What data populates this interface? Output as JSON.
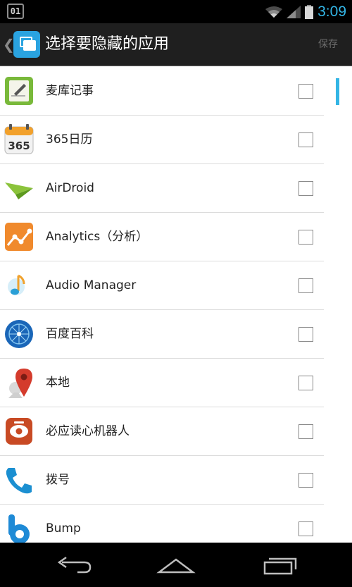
{
  "status_bar": {
    "notification_badge": "01",
    "time": "3:09",
    "accent": "#33b5e5"
  },
  "action_bar": {
    "title": "选择要隐藏的应用",
    "save_label": "保存",
    "app_icon": "copy-icon"
  },
  "apps": [
    {
      "name": " 麦库记事",
      "icon": "notes-icon",
      "checked": false
    },
    {
      "name": "365日历",
      "icon": "calendar-icon",
      "checked": false
    },
    {
      "name": "AirDroid",
      "icon": "paper-plane-icon",
      "checked": false
    },
    {
      "name": "Analytics（分析）",
      "icon": "analytics-icon",
      "checked": false
    },
    {
      "name": "Audio Manager",
      "icon": "music-note-icon",
      "checked": false
    },
    {
      "name": "百度百科",
      "icon": "globe-icon",
      "checked": false
    },
    {
      "name": "本地",
      "icon": "map-pin-icon",
      "checked": false
    },
    {
      "name": "必应读心机器人",
      "icon": "robot-icon",
      "checked": false
    },
    {
      "name": "拨号",
      "icon": "phone-icon",
      "checked": false
    },
    {
      "name": "Bump",
      "icon": "bump-icon",
      "checked": false
    }
  ],
  "nav_bar": {
    "back": "back-arrow-icon",
    "home": "home-icon",
    "recents": "recent-apps-icon"
  }
}
